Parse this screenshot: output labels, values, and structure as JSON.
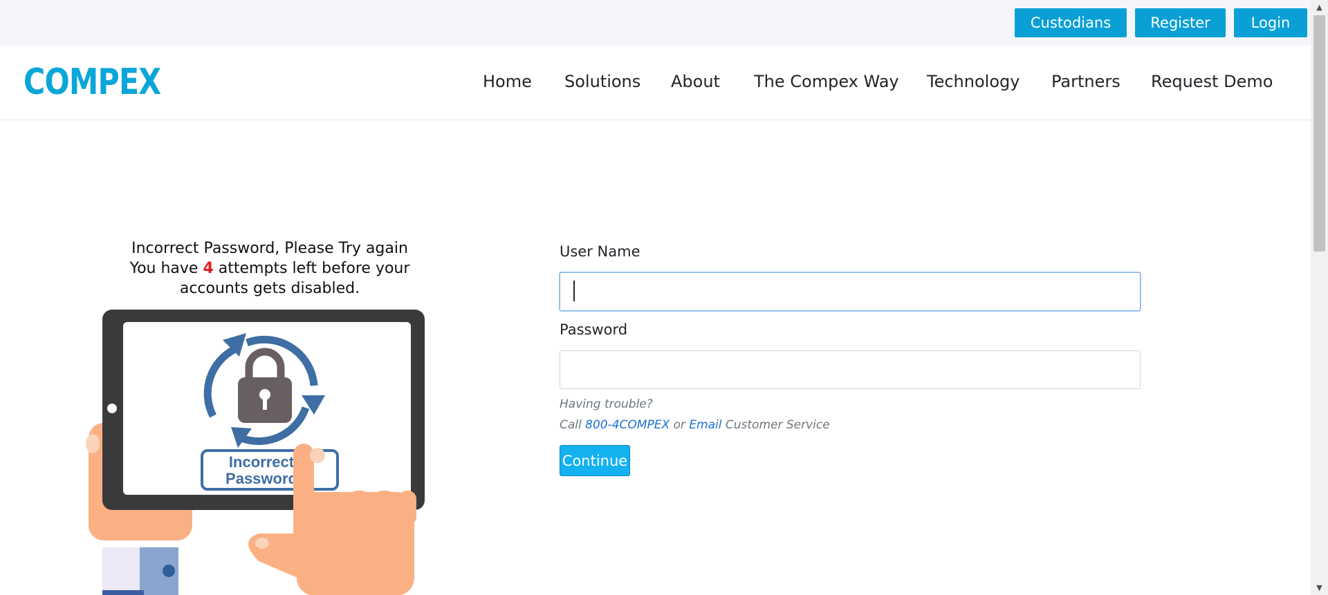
{
  "topbar": {
    "custodians_label": "Custodians",
    "register_label": "Register",
    "login_label": "Login",
    "button_color": "#0aa0d6"
  },
  "brand": {
    "logo_text": "COMPEX",
    "color": "#0aa6d8"
  },
  "nav": {
    "home": "Home",
    "solutions": "Solutions",
    "about": "About",
    "compex_way": "The Compex Way",
    "technology": "Technology",
    "partners": "Partners",
    "request_demo": "Request Demo"
  },
  "message": {
    "line1": "Incorrect Password, Please Try again",
    "line2_prefix": "You have",
    "attempts_left": "4",
    "line2_suffix": "attempts left before your",
    "line3": "accounts gets disabled.",
    "count_color": "#e01b1b"
  },
  "illustration": {
    "icon": "tablet-locked-padlock-icon",
    "badge_line1": "Incorrect",
    "badge_line2": "Password"
  },
  "form": {
    "username_label": "User Name",
    "username_value": "",
    "password_label": "Password",
    "password_value": "",
    "trouble_text": "Having trouble?",
    "call_prefix": "Call",
    "phone_link": "800-4COMPEX",
    "or_text": "or",
    "email_link": "Email",
    "service_text": "Customer Service",
    "continue_label": "Continue"
  }
}
